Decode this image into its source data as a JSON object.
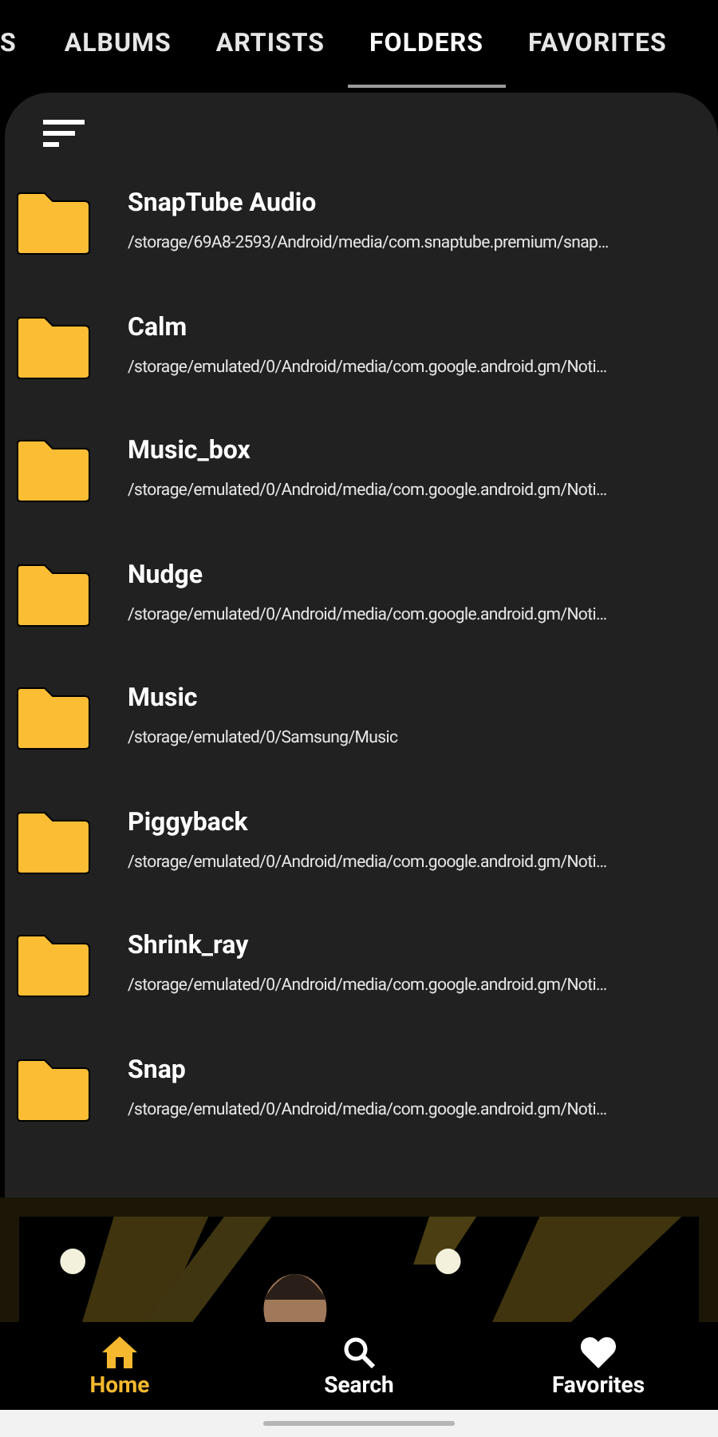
{
  "tabs": [
    {
      "label": "S",
      "selected": false
    },
    {
      "label": "ALBUMS",
      "selected": false
    },
    {
      "label": "ARTISTS",
      "selected": false
    },
    {
      "label": "FOLDERS",
      "selected": true
    },
    {
      "label": "FAVORITES",
      "selected": false
    }
  ],
  "folders": [
    {
      "name": "SnapTube Audio",
      "path": "/storage/69A8-2593/Android/media/com.snaptube.premium/snap…"
    },
    {
      "name": "Calm",
      "path": "/storage/emulated/0/Android/media/com.google.android.gm/Noti…"
    },
    {
      "name": "Music_box",
      "path": "/storage/emulated/0/Android/media/com.google.android.gm/Noti…"
    },
    {
      "name": "Nudge",
      "path": "/storage/emulated/0/Android/media/com.google.android.gm/Noti…"
    },
    {
      "name": "Music",
      "path": "/storage/emulated/0/Samsung/Music"
    },
    {
      "name": "Piggyback",
      "path": "/storage/emulated/0/Android/media/com.google.android.gm/Noti…"
    },
    {
      "name": "Shrink_ray",
      "path": "/storage/emulated/0/Android/media/com.google.android.gm/Noti…"
    },
    {
      "name": "Snap",
      "path": "/storage/emulated/0/Android/media/com.google.android.gm/Noti…"
    }
  ],
  "bottom_nav": [
    {
      "label": "Home",
      "kind": "home",
      "selected": true
    },
    {
      "label": "Search",
      "kind": "search",
      "selected": false
    },
    {
      "label": "Favorites",
      "kind": "heart",
      "selected": false
    }
  ]
}
